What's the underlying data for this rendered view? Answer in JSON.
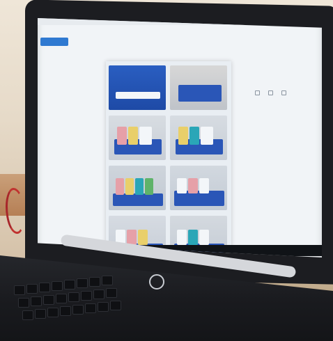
{
  "screen": {
    "app": {
      "title": "",
      "primary_button": "",
      "secondary_button": ""
    },
    "right_actions": {
      "label1": "",
      "label2": ""
    }
  }
}
